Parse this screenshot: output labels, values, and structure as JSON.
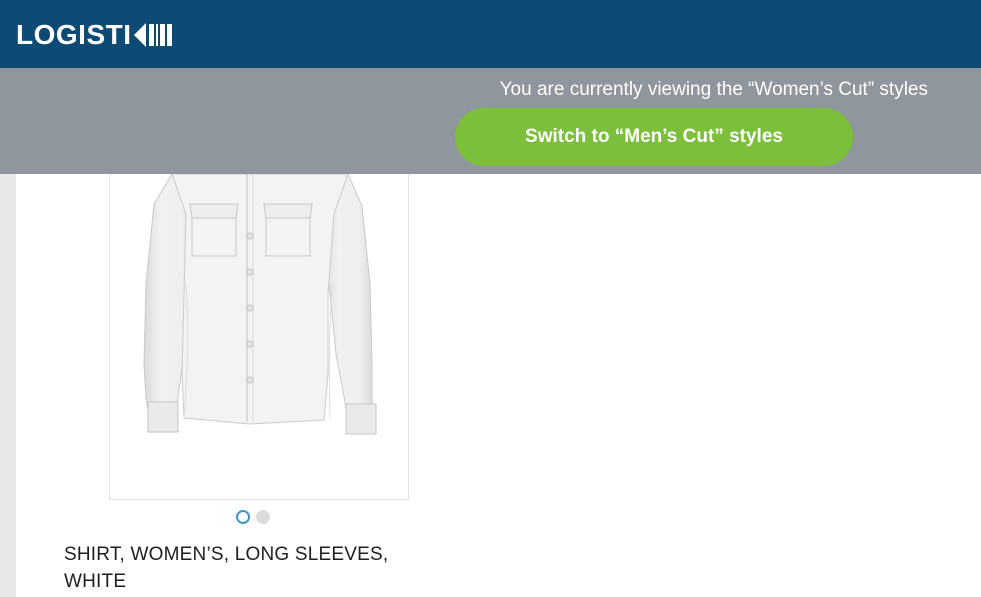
{
  "header": {
    "logo_text": "LOGISTI",
    "logo_mark_icon": "logistik-k-barcode-icon"
  },
  "banner": {
    "message": "You are currently viewing the “Women’s Cut” styles",
    "switch_button_label": "Switch to “Men’s Cut” styles"
  },
  "product": {
    "image_icon": "white-womens-long-sleeve-shirt",
    "carousel": {
      "total": 2,
      "active_index": 1
    },
    "title_line1": "SHIRT, WOMEN’S, LONG SLEEVES,",
    "title_line2": "WHITE"
  },
  "colors": {
    "header_bg": "#0d4a74",
    "banner_bg": "#8f969d",
    "button_bg": "#7bbf3b",
    "dot_active": "#3a95c9",
    "dot_inactive": "#dcdcdc"
  }
}
